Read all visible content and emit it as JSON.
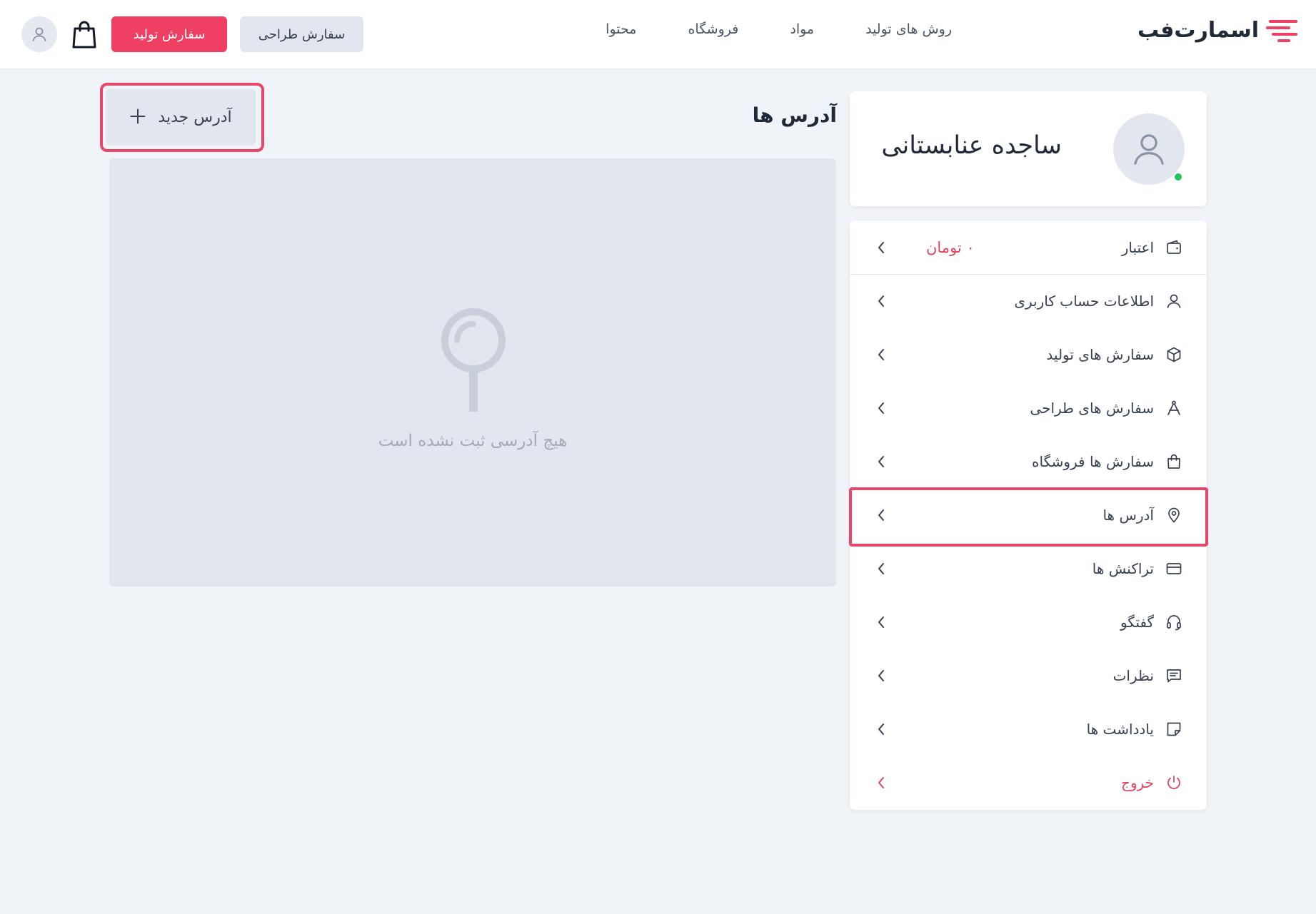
{
  "brand": {
    "name": "اسمارت‌فب",
    "accent": "#ef3f62"
  },
  "nav": {
    "items": [
      {
        "label": "روش های تولید"
      },
      {
        "label": "مواد"
      },
      {
        "label": "فروشگاه"
      },
      {
        "label": "محتوا"
      }
    ]
  },
  "header_actions": {
    "design_order_label": "سفارش طراحی",
    "production_order_label": "سفارش تولید",
    "cart_icon": "shopping-bag-icon",
    "user_icon": "user-icon"
  },
  "profile": {
    "name": "ساجده عنابستانی",
    "status": "online"
  },
  "menu": {
    "items": [
      {
        "label": "اعتبار",
        "value": "۰ تومان",
        "icon": "wallet-icon"
      },
      {
        "label": "اطلاعات حساب کاربری",
        "icon": "user-icon"
      },
      {
        "label": "سفارش های تولید",
        "icon": "cube-icon"
      },
      {
        "label": "سفارش های طراحی",
        "icon": "compass-icon"
      },
      {
        "label": "سفارش ها فروشگاه",
        "icon": "shopping-bag-icon"
      },
      {
        "label": "آدرس ها",
        "icon": "location-pin-icon",
        "active": true
      },
      {
        "label": "تراکنش ها",
        "icon": "credit-card-icon"
      },
      {
        "label": "گفتگو",
        "icon": "headset-icon"
      },
      {
        "label": "نظرات",
        "icon": "comment-icon"
      },
      {
        "label": "یادداشت ها",
        "icon": "note-icon"
      },
      {
        "label": "خروج",
        "icon": "power-icon"
      }
    ]
  },
  "addresses": {
    "title": "آدرس ها",
    "new_button_label": "آدرس جدید",
    "empty_text": "هیچ آدرسی ثبت نشده است"
  },
  "colors": {
    "primary": "#ef3f62",
    "background": "#f0f3f8",
    "panel": "#e2e7ef",
    "danger_text": "#e0455f",
    "online": "#22c55e"
  }
}
